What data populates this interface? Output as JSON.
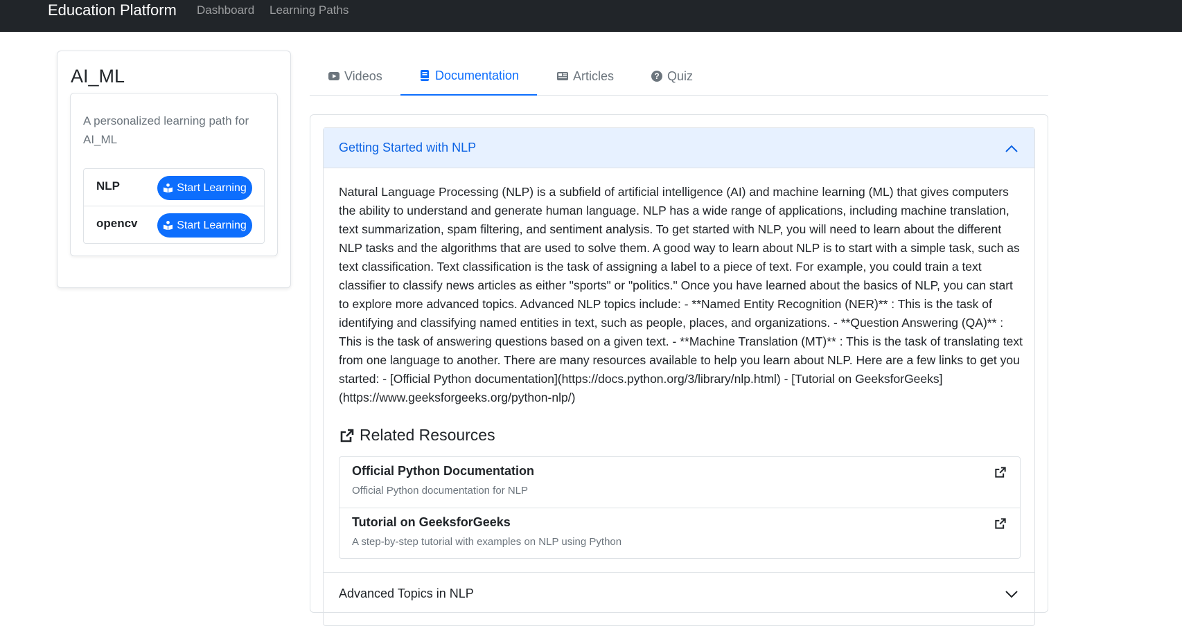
{
  "navbar": {
    "brand": "Education Platform",
    "links": [
      "Dashboard",
      "Learning Paths"
    ]
  },
  "sidebar": {
    "title": "AI_ML",
    "description": "A personalized learning path for AI_ML",
    "topics": [
      {
        "name": "NLP",
        "button": "Start Learning"
      },
      {
        "name": "opencv",
        "button": "Start Learning"
      }
    ]
  },
  "tabs": [
    {
      "label": "Videos",
      "icon": "youtube-icon"
    },
    {
      "label": "Documentation",
      "icon": "book-icon"
    },
    {
      "label": "Articles",
      "icon": "newspaper-icon"
    },
    {
      "label": "Quiz",
      "icon": "question-circle-icon"
    }
  ],
  "active_tab": "Documentation",
  "accordion": {
    "item1": {
      "title": "Getting Started with NLP",
      "expanded": true,
      "body": "Natural Language Processing (NLP) is a subfield of artificial intelligence (AI) and machine learning (ML) that gives computers the ability to understand and generate human language. NLP has a wide range of applications, including machine translation, text summarization, spam filtering, and sentiment analysis. To get started with NLP, you will need to learn about the different NLP tasks and the algorithms that are used to solve them. A good way to learn about NLP is to start with a simple task, such as text classification. Text classification is the task of assigning a label to a piece of text. For example, you could train a text classifier to classify news articles as either \"sports\" or \"politics.\" Once you have learned about the basics of NLP, you can start to explore more advanced topics. Advanced NLP topics include: - **Named Entity Recognition (NER)** : This is the task of identifying and classifying named entities in text, such as people, places, and organizations. - **Question Answering (QA)** : This is the task of answering questions based on a given text. - **Machine Translation (MT)** : This is the task of translating text from one language to another. There are many resources available to help you learn about NLP. Here are a few links to get you started: - [Official Python documentation](https://docs.python.org/3/library/nlp.html) - [Tutorial on GeeksforGeeks](https://www.geeksforgeeks.org/python-nlp/)",
      "related_title": "Related Resources",
      "resources": [
        {
          "name": "Official Python Documentation",
          "desc": "Official Python documentation for NLP"
        },
        {
          "name": "Tutorial on GeeksforGeeks",
          "desc": "A step-by-step tutorial with examples on NLP using Python"
        }
      ]
    },
    "item2": {
      "title": "Advanced Topics in NLP",
      "expanded": false
    }
  },
  "colors": {
    "navbar_bg": "#212529",
    "primary": "#0d6efd",
    "accordion_header_bg": "#e7f1ff",
    "muted_text": "#6c757d"
  }
}
